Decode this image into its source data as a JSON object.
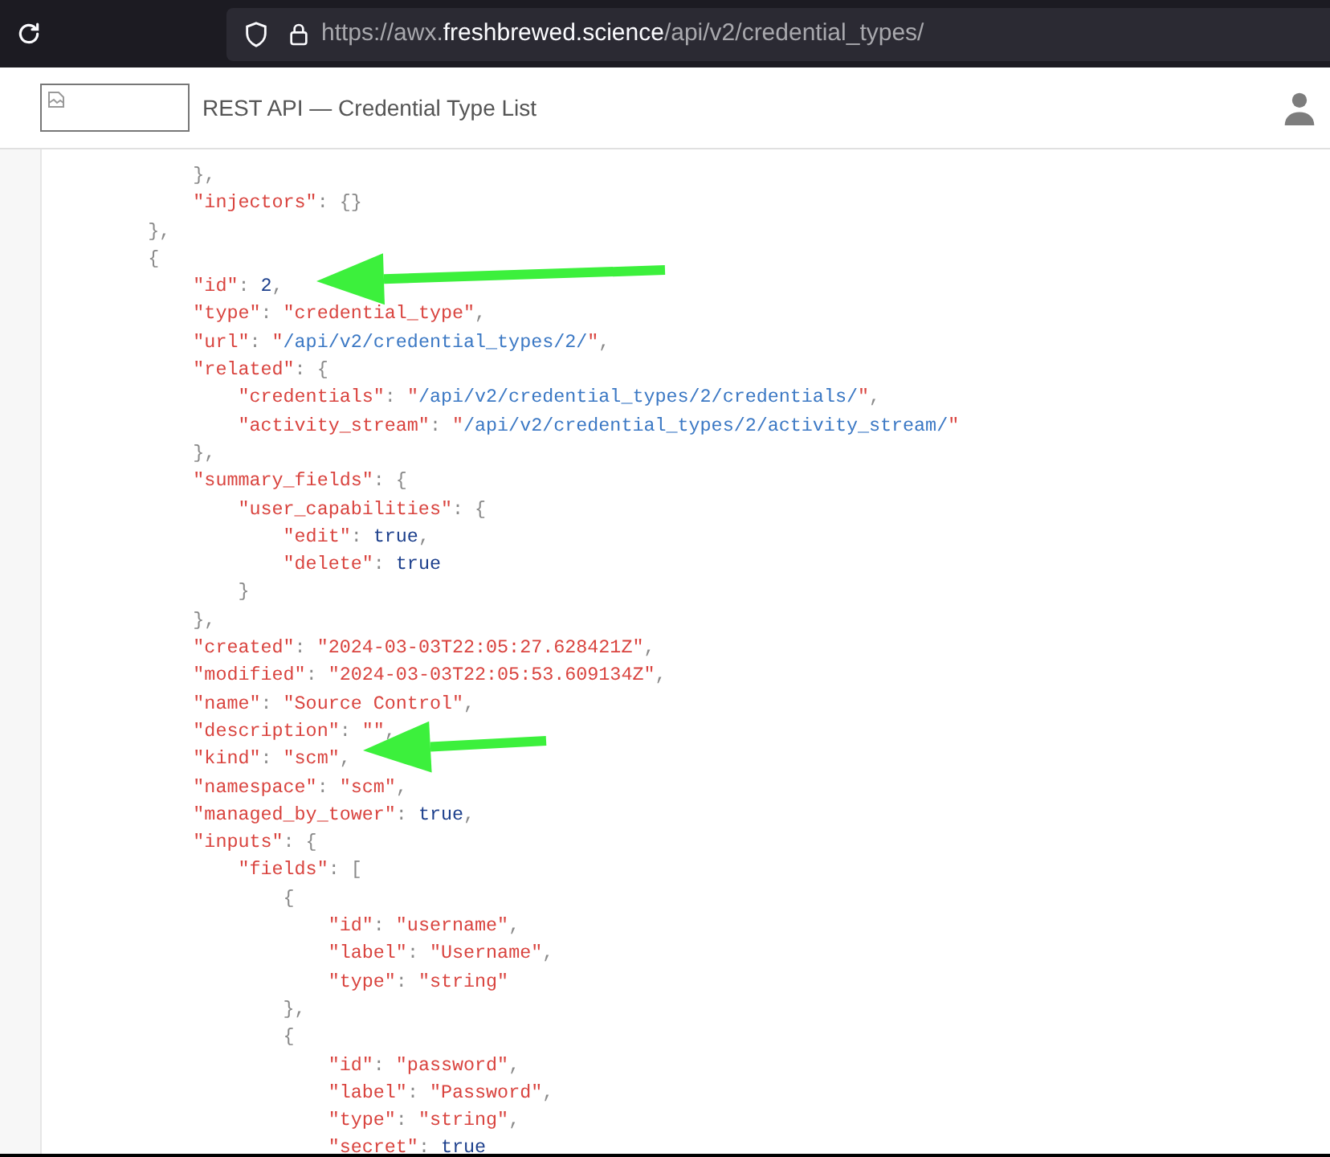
{
  "browser": {
    "url": {
      "prefix": "https://awx.",
      "domain": "freshbrewed.science",
      "path": "/api/v2/credential_types/"
    }
  },
  "header": {
    "title": "REST API — Credential Type List"
  },
  "code_lines": [
    [
      {
        "text": "            },",
        "kind": "punct"
      }
    ],
    [
      {
        "text": "            \"injectors\"",
        "kind": "key"
      },
      {
        "text": ": {}",
        "kind": "punct"
      }
    ],
    [
      {
        "text": "        },",
        "kind": "punct"
      }
    ],
    [
      {
        "text": "        {",
        "kind": "punct"
      }
    ],
    [
      {
        "text": "            \"id\"",
        "kind": "key"
      },
      {
        "text": ": ",
        "kind": "punct"
      },
      {
        "text": "2",
        "kind": "lit"
      },
      {
        "text": ",",
        "kind": "punct"
      }
    ],
    [
      {
        "text": "            \"type\"",
        "kind": "key"
      },
      {
        "text": ": ",
        "kind": "punct"
      },
      {
        "text": "\"credential_type\"",
        "kind": "str"
      },
      {
        "text": ",",
        "kind": "punct"
      }
    ],
    [
      {
        "text": "            \"url\"",
        "kind": "key"
      },
      {
        "text": ": ",
        "kind": "punct"
      },
      {
        "text": "\"",
        "kind": "str"
      },
      {
        "text": "/api/v2/credential_types/2/",
        "kind": "link"
      },
      {
        "text": "\"",
        "kind": "str"
      },
      {
        "text": ",",
        "kind": "punct"
      }
    ],
    [
      {
        "text": "            \"related\"",
        "kind": "key"
      },
      {
        "text": ": {",
        "kind": "punct"
      }
    ],
    [
      {
        "text": "                \"credentials\"",
        "kind": "key"
      },
      {
        "text": ": ",
        "kind": "punct"
      },
      {
        "text": "\"",
        "kind": "str"
      },
      {
        "text": "/api/v2/credential_types/2/credentials/",
        "kind": "link"
      },
      {
        "text": "\"",
        "kind": "str"
      },
      {
        "text": ",",
        "kind": "punct"
      }
    ],
    [
      {
        "text": "                \"activity_stream\"",
        "kind": "key"
      },
      {
        "text": ": ",
        "kind": "punct"
      },
      {
        "text": "\"",
        "kind": "str"
      },
      {
        "text": "/api/v2/credential_types/2/activity_stream/",
        "kind": "link"
      },
      {
        "text": "\"",
        "kind": "str"
      }
    ],
    [
      {
        "text": "            },",
        "kind": "punct"
      }
    ],
    [
      {
        "text": "            \"summary_fields\"",
        "kind": "key"
      },
      {
        "text": ": {",
        "kind": "punct"
      }
    ],
    [
      {
        "text": "                \"user_capabilities\"",
        "kind": "key"
      },
      {
        "text": ": {",
        "kind": "punct"
      }
    ],
    [
      {
        "text": "                    \"edit\"",
        "kind": "key"
      },
      {
        "text": ": ",
        "kind": "punct"
      },
      {
        "text": "true",
        "kind": "lit"
      },
      {
        "text": ",",
        "kind": "punct"
      }
    ],
    [
      {
        "text": "                    \"delete\"",
        "kind": "key"
      },
      {
        "text": ": ",
        "kind": "punct"
      },
      {
        "text": "true",
        "kind": "lit"
      }
    ],
    [
      {
        "text": "                }",
        "kind": "punct"
      }
    ],
    [
      {
        "text": "            },",
        "kind": "punct"
      }
    ],
    [
      {
        "text": "            \"created\"",
        "kind": "key"
      },
      {
        "text": ": ",
        "kind": "punct"
      },
      {
        "text": "\"2024-03-03T22:05:27.628421Z\"",
        "kind": "str"
      },
      {
        "text": ",",
        "kind": "punct"
      }
    ],
    [
      {
        "text": "            \"modified\"",
        "kind": "key"
      },
      {
        "text": ": ",
        "kind": "punct"
      },
      {
        "text": "\"2024-03-03T22:05:53.609134Z\"",
        "kind": "str"
      },
      {
        "text": ",",
        "kind": "punct"
      }
    ],
    [
      {
        "text": "            \"name\"",
        "kind": "key"
      },
      {
        "text": ": ",
        "kind": "punct"
      },
      {
        "text": "\"Source Control\"",
        "kind": "str"
      },
      {
        "text": ",",
        "kind": "punct"
      }
    ],
    [
      {
        "text": "            \"description\"",
        "kind": "key"
      },
      {
        "text": ": ",
        "kind": "punct"
      },
      {
        "text": "\"\"",
        "kind": "str"
      },
      {
        "text": ",",
        "kind": "punct"
      }
    ],
    [
      {
        "text": "            \"kind\"",
        "kind": "key"
      },
      {
        "text": ": ",
        "kind": "punct"
      },
      {
        "text": "\"scm\"",
        "kind": "str"
      },
      {
        "text": ",",
        "kind": "punct"
      }
    ],
    [
      {
        "text": "            \"namespace\"",
        "kind": "key"
      },
      {
        "text": ": ",
        "kind": "punct"
      },
      {
        "text": "\"scm\"",
        "kind": "str"
      },
      {
        "text": ",",
        "kind": "punct"
      }
    ],
    [
      {
        "text": "            \"managed_by_tower\"",
        "kind": "key"
      },
      {
        "text": ": ",
        "kind": "punct"
      },
      {
        "text": "true",
        "kind": "lit"
      },
      {
        "text": ",",
        "kind": "punct"
      }
    ],
    [
      {
        "text": "            \"inputs\"",
        "kind": "key"
      },
      {
        "text": ": {",
        "kind": "punct"
      }
    ],
    [
      {
        "text": "                \"fields\"",
        "kind": "key"
      },
      {
        "text": ": [",
        "kind": "punct"
      }
    ],
    [
      {
        "text": "                    {",
        "kind": "punct"
      }
    ],
    [
      {
        "text": "                        \"id\"",
        "kind": "key"
      },
      {
        "text": ": ",
        "kind": "punct"
      },
      {
        "text": "\"username\"",
        "kind": "str"
      },
      {
        "text": ",",
        "kind": "punct"
      }
    ],
    [
      {
        "text": "                        \"label\"",
        "kind": "key"
      },
      {
        "text": ": ",
        "kind": "punct"
      },
      {
        "text": "\"Username\"",
        "kind": "str"
      },
      {
        "text": ",",
        "kind": "punct"
      }
    ],
    [
      {
        "text": "                        \"type\"",
        "kind": "key"
      },
      {
        "text": ": ",
        "kind": "punct"
      },
      {
        "text": "\"string\"",
        "kind": "str"
      }
    ],
    [
      {
        "text": "                    },",
        "kind": "punct"
      }
    ],
    [
      {
        "text": "                    {",
        "kind": "punct"
      }
    ],
    [
      {
        "text": "                        \"id\"",
        "kind": "key"
      },
      {
        "text": ": ",
        "kind": "punct"
      },
      {
        "text": "\"password\"",
        "kind": "str"
      },
      {
        "text": ",",
        "kind": "punct"
      }
    ],
    [
      {
        "text": "                        \"label\"",
        "kind": "key"
      },
      {
        "text": ": ",
        "kind": "punct"
      },
      {
        "text": "\"Password\"",
        "kind": "str"
      },
      {
        "text": ",",
        "kind": "punct"
      }
    ],
    [
      {
        "text": "                        \"type\"",
        "kind": "key"
      },
      {
        "text": ": ",
        "kind": "punct"
      },
      {
        "text": "\"string\"",
        "kind": "str"
      },
      {
        "text": ",",
        "kind": "punct"
      }
    ],
    [
      {
        "text": "                        \"secret\"",
        "kind": "key"
      },
      {
        "text": ": ",
        "kind": "punct"
      },
      {
        "text": "true",
        "kind": "lit"
      }
    ]
  ]
}
